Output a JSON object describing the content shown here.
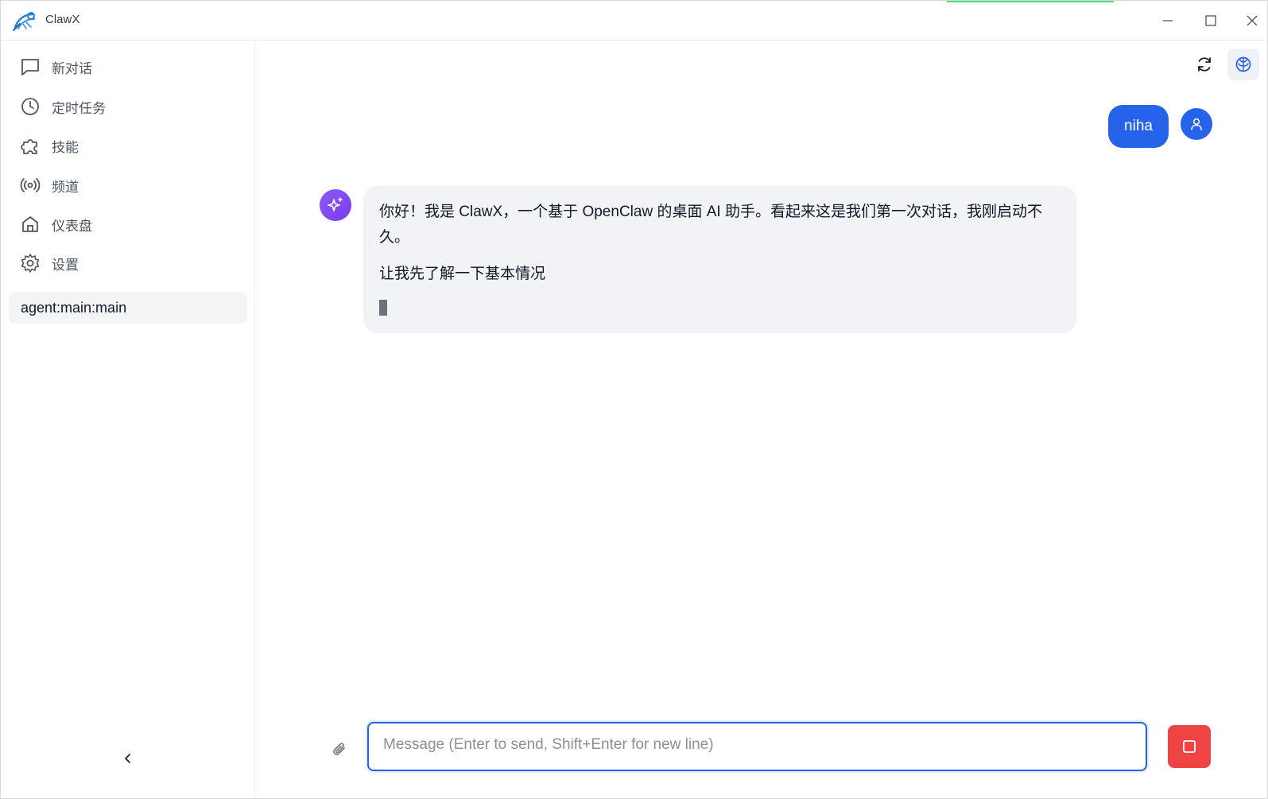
{
  "app": {
    "title": "ClawX"
  },
  "window_controls": {
    "minimize_icon": "minimize-icon",
    "maximize_icon": "maximize-icon",
    "close_icon": "close-icon"
  },
  "sidebar": {
    "items": [
      {
        "label": "新对话",
        "icon": "chat-icon"
      },
      {
        "label": "定时任务",
        "icon": "clock-icon"
      },
      {
        "label": "技能",
        "icon": "puzzle-icon"
      },
      {
        "label": "频道",
        "icon": "broadcast-icon"
      },
      {
        "label": "仪表盘",
        "icon": "home-icon"
      },
      {
        "label": "设置",
        "icon": "gear-icon"
      }
    ],
    "sessions": [
      {
        "label": "agent:main:main"
      }
    ],
    "collapse_icon": "chevron-left-icon"
  },
  "toolbar": {
    "refresh_icon": "refresh-icon",
    "brain_icon": "brain-icon"
  },
  "chat": {
    "user_message": "niha",
    "assistant_paragraphs": [
      "你好！我是 ClawX，一个基于 OpenClaw 的桌面 AI 助手。看起来这是我们第一次对话，我刚启动不久。",
      "让我先了解一下基本情况"
    ]
  },
  "composer": {
    "placeholder": "Message (Enter to send, Shift+Enter for new line)",
    "value": "",
    "attach_icon": "paperclip-icon",
    "stop_icon": "stop-icon"
  },
  "colors": {
    "accent": "#2563eb",
    "stop": "#ef4444",
    "ai_avatar": "#7c3aed",
    "bubble": "#f1f3f6"
  }
}
